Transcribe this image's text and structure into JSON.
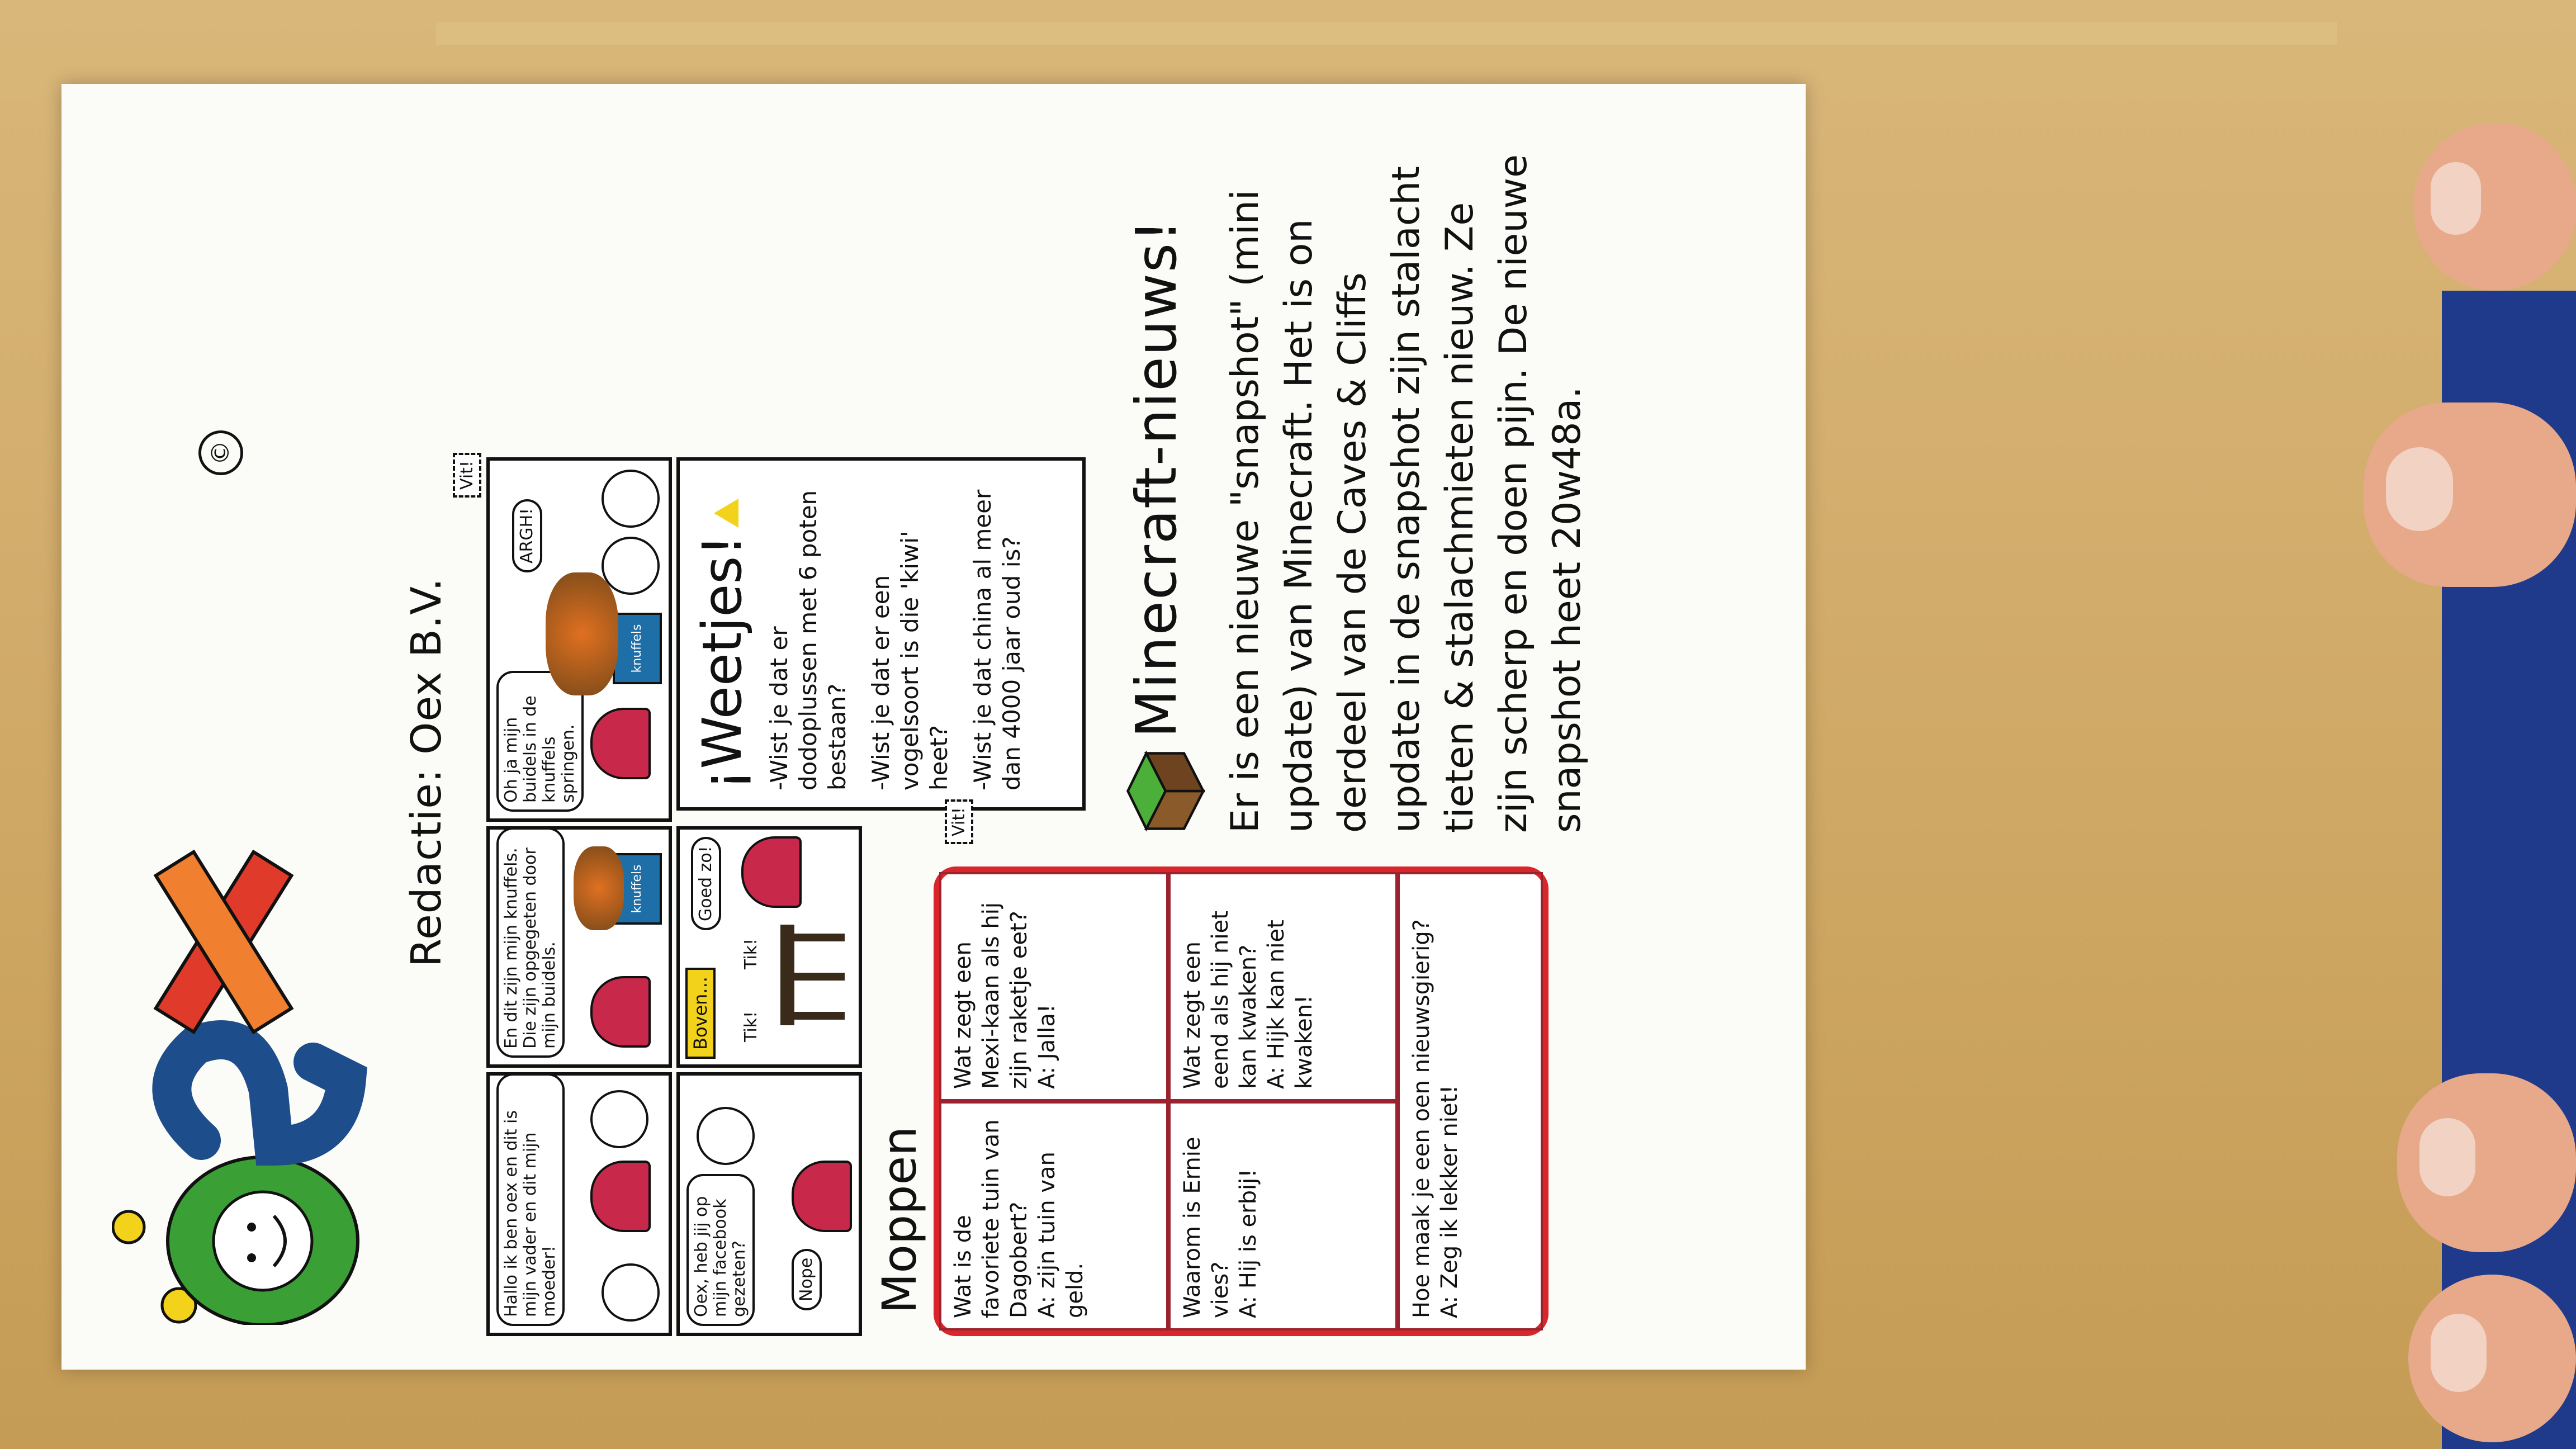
{
  "brand": {
    "logo_text": "Oex",
    "redactie": "Redactie: Oex B.V.",
    "copyright_symbol": "©",
    "colors": {
      "green": "#3aa035",
      "blue": "#1e4d8c",
      "orange": "#f08030",
      "red": "#e03a2a",
      "yellow": "#f2d21a"
    }
  },
  "comic": {
    "panel1": {
      "bubble": "Hallo ik ben oex en dit is mijn vader en dit mijn moeder!"
    },
    "panel2": {
      "bubble": "En dit zijn mijn knuffels. Die zijn opgegeten door mijn buidels.",
      "box_label": "knuffels"
    },
    "panel3": {
      "bubble": "Oh ja mijn buidels in de knuffels springen.",
      "box_label": "knuffels",
      "shout": "ARGH!",
      "tag": "Vit!"
    },
    "panel4": {
      "bubble": "Oex, heb jij op mijn facebook gezeten?",
      "reply": "Nope"
    },
    "panel5": {
      "label": "Boven...",
      "sound1": "Tik!",
      "sound2": "Tik!",
      "bubble": "Goed zo!"
    }
  },
  "weetjes": {
    "title": "¡Weetjes!",
    "items": [
      "-Wist je dat er dodoplussen met 6 poten bestaan?",
      "-Wist je dat er een vogelsoort is die 'kiwi' heet?",
      "-Wist je dat china al meer dan 4000 jaar oud is?"
    ],
    "tag": "Vit!"
  },
  "moppen": {
    "title": "Moppen",
    "items": [
      {
        "q": "Wat is de favoriete tuin van Dagobert?",
        "a": "A: zijn tuin van geld."
      },
      {
        "q": "Wat zegt een Mexi-kaan als hij zijn raketje eet?",
        "a": "A: Jalla!"
      },
      {
        "q": "Waarom is Ernie vies?",
        "a": "A: Hij is erbij!"
      },
      {
        "q": "Wat zegt een eend als hij niet kan kwaken?",
        "a": "A: Hijk kan niet kwaken!"
      },
      {
        "q": "Hoe maak je een oen nieuwsgierig?",
        "a": "A: Zeg ik lekker niet!"
      }
    ]
  },
  "minecraft": {
    "title": "Minecraft-nieuws!",
    "body": "Er is een nieuwe \"snapshot\" (mini update) van Minecraft. Het is on derdeel van de Caves & Cliffs update in de snapshot zijn stalacht tieten & stalachmieten nieuw. Ze zijn scherp en doen pijn. De nieuwe snapshot heet 20w48a."
  }
}
